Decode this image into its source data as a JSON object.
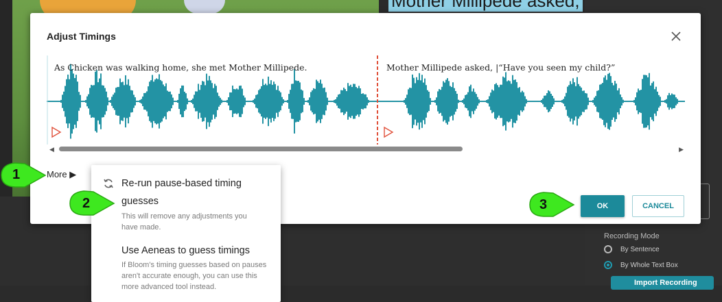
{
  "background": {
    "book_text": "Mother Millipede asked,",
    "recording_mode_label": "Recording Mode",
    "by_sentence_label": "By Sentence",
    "by_whole_text_box_label": "By Whole Text Box",
    "import_recording_label": "Import Recording"
  },
  "dialog": {
    "title": "Adjust Timings",
    "segments": [
      {
        "text": "As Chicken was walking home, she met Mother Millipede."
      },
      {
        "text": "Mother Millipede asked, |“Have you seen my child?”"
      }
    ],
    "more_label": "More ▶",
    "ok_label": "OK",
    "cancel_label": "CANCEL",
    "waveform_color": "#2393a4",
    "marker_color": "#e0503a"
  },
  "more_menu": {
    "items": [
      {
        "title": "Re-run pause-based timing guesses",
        "description": "This will remove any adjustments you have made."
      },
      {
        "title": "Use Aeneas to guess timings",
        "description": "If Bloom's timing guesses based on pauses aren't accurate enough, you can use this more advanced tool instead."
      }
    ]
  },
  "callouts": [
    "1",
    "2",
    "3"
  ]
}
